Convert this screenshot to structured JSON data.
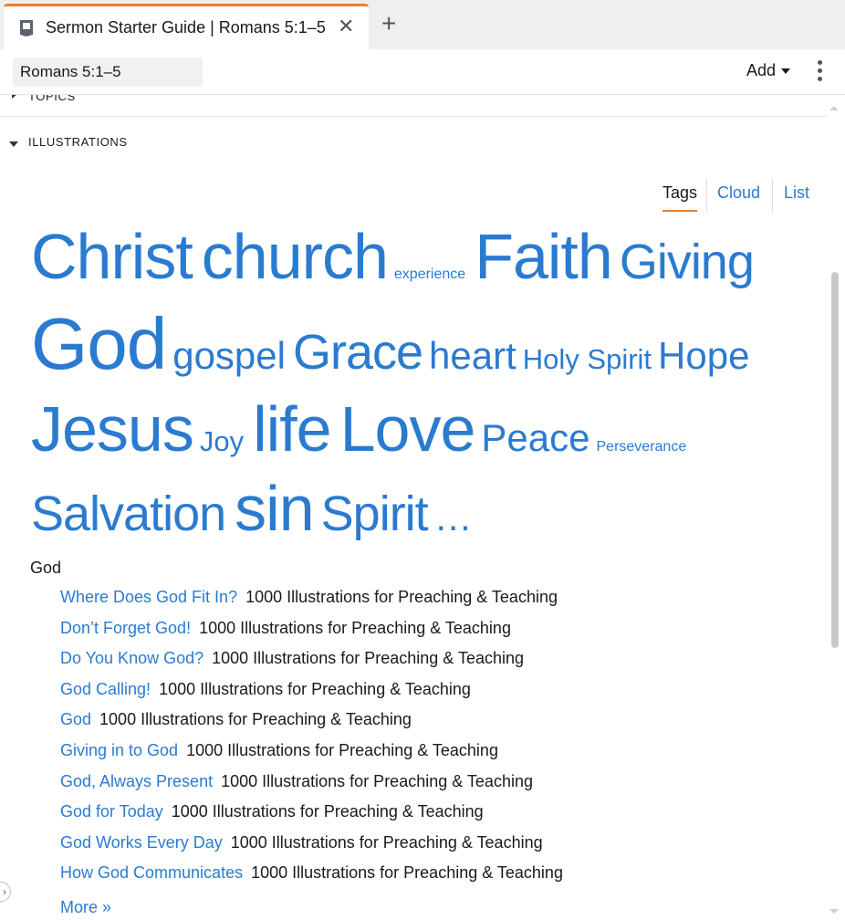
{
  "tab": {
    "title": "Sermon Starter Guide | Romans 5:1–5",
    "close_glyph": "✕",
    "new_tab_glyph": "+",
    "icon": "guide-book-icon"
  },
  "toolbar": {
    "reference_value": "Romans 5:1–5",
    "add_label": "Add",
    "menu_icon": "kebab-menu-icon"
  },
  "sections": {
    "topics_label": "TOPICS",
    "illustrations_label": "ILLUSTRATIONS"
  },
  "view_tabs": {
    "tags": "Tags",
    "cloud": "Cloud",
    "list": "List",
    "active": "Tags"
  },
  "tag_cloud": {
    "lines": [
      [
        {
          "label": "Christ",
          "size_rank": 5
        },
        {
          "label": "church",
          "size_rank": 5
        },
        {
          "label": "experience",
          "size_rank": 1
        },
        {
          "label": "Faith",
          "size_rank": 5
        },
        {
          "label": "Giving",
          "size_rank": 4
        }
      ],
      [
        {
          "label": "God",
          "size_rank": 6
        },
        {
          "label": "gospel",
          "size_rank": 3
        },
        {
          "label": "Grace",
          "size_rank": 4
        },
        {
          "label": "heart",
          "size_rank": 3
        },
        {
          "label": "Holy Spirit",
          "size_rank": 2
        },
        {
          "label": "Hope",
          "size_rank": 3
        }
      ],
      [
        {
          "label": "Jesus",
          "size_rank": 5
        },
        {
          "label": "Joy",
          "size_rank": 2
        },
        {
          "label": "life",
          "size_rank": 5
        },
        {
          "label": "Love",
          "size_rank": 5
        },
        {
          "label": "Peace",
          "size_rank": 3
        },
        {
          "label": "Perseverance",
          "size_rank": 1
        }
      ],
      [
        {
          "label": "Salvation",
          "size_rank": 4
        },
        {
          "label": "sin",
          "size_rank": 5
        },
        {
          "label": "Spirit",
          "size_rank": 4
        },
        {
          "label": "…",
          "size_rank": 3
        }
      ]
    ]
  },
  "results": {
    "group_title": "God",
    "items": [
      {
        "title": "Where Does God Fit In?",
        "source": "1000 Illustrations for Preaching & Teaching"
      },
      {
        "title": "Don’t Forget God!",
        "source": "1000 Illustrations for Preaching & Teaching"
      },
      {
        "title": "Do You Know God?",
        "source": "1000 Illustrations for Preaching & Teaching"
      },
      {
        "title": "God Calling!",
        "source": "1000 Illustrations for Preaching & Teaching"
      },
      {
        "title": "God",
        "source": "1000 Illustrations for Preaching & Teaching"
      },
      {
        "title": "Giving in to God",
        "source": "1000 Illustrations for Preaching & Teaching"
      },
      {
        "title": "God, Always Present",
        "source": "1000 Illustrations for Preaching & Teaching"
      },
      {
        "title": "God for Today",
        "source": "1000 Illustrations for Preaching & Teaching"
      },
      {
        "title": "God Works Every Day",
        "source": "1000 Illustrations for Preaching & Teaching"
      },
      {
        "title": "How God Communicates",
        "source": "1000 Illustrations for Preaching & Teaching"
      }
    ],
    "more_label": "More »"
  },
  "colors": {
    "accent": "#f07c22",
    "link": "#2a7bd0",
    "text": "#1a1a1a"
  }
}
